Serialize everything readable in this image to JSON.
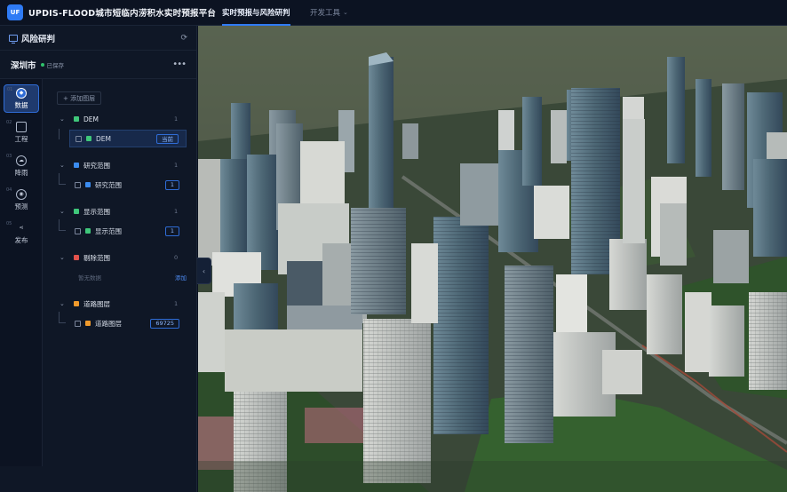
{
  "app": {
    "logo": "UF",
    "title": "UPDIS-FLOOD城市短临内涝积水实时预报平台"
  },
  "nav": {
    "tabs": [
      {
        "label": "实时预报与风险研判",
        "active": true
      },
      {
        "label": "开发工具",
        "has_dropdown": true
      }
    ]
  },
  "panel": {
    "title": "风险研判",
    "city": "深圳市",
    "saved_status": "已保存"
  },
  "sidenav": {
    "items": [
      {
        "num": "01",
        "label": "数据",
        "icon": "shield-icon",
        "active": true
      },
      {
        "num": "02",
        "label": "工程",
        "icon": "folder-icon"
      },
      {
        "num": "03",
        "label": "降雨",
        "icon": "rain-icon"
      },
      {
        "num": "04",
        "label": "预测",
        "icon": "target-icon"
      },
      {
        "num": "05",
        "label": "发布",
        "icon": "share-icon"
      }
    ]
  },
  "layers": {
    "add_label": "添加图层",
    "groups": [
      {
        "name": "DEM",
        "color": "#3fc77a",
        "count": "1",
        "child": {
          "name": "DEM",
          "color": "#3fc77a",
          "badge": "当前",
          "selected": true
        }
      },
      {
        "name": "研究范围",
        "color": "#3b8cf0",
        "count": "1",
        "child": {
          "name": "研究范围",
          "color": "#3b8cf0",
          "badge": "1"
        }
      },
      {
        "name": "显示范围",
        "color": "#3fc77a",
        "count": "1",
        "child": {
          "name": "显示范围",
          "color": "#3fc77a",
          "badge": "1"
        }
      },
      {
        "name": "剔除范围",
        "color": "#e2524c",
        "count": "0",
        "empty_text": "暂无数据",
        "add_text": "添加"
      },
      {
        "name": "道路图层",
        "color": "#f09a2c",
        "count": "1",
        "child": {
          "name": "道路图层",
          "color": "#f09a2c",
          "badge": "69725"
        }
      }
    ]
  },
  "colors": {
    "accent": "#2f7bf5",
    "panel_bg": "#0f1726",
    "map_ground": "#3d4a3a",
    "vegetation": "#2f5a2c"
  }
}
